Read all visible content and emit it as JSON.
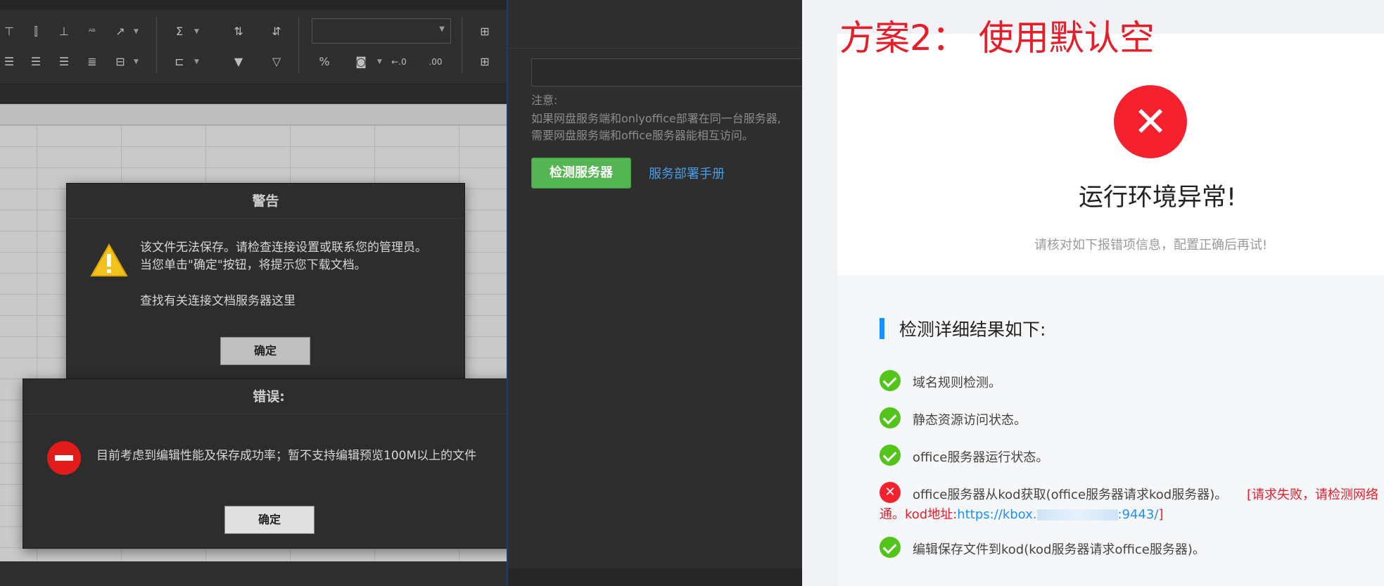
{
  "left": {
    "warning_dialog": {
      "title": "警告",
      "line1": "该文件无法保存。请检查连接设置或联系您的管理员。",
      "line2": "当您单击\"确定\"按钮，将提示您下载文档。",
      "line3": "查找有关连接文档服务器这里",
      "ok_label": "确定"
    },
    "error_dialog": {
      "title": "错误:",
      "message": "目前考虑到编辑性能及保存成功率；暂不支持编辑预览100M以上的文件",
      "ok_label": "确定"
    }
  },
  "middle": {
    "note_label": "注意:",
    "note_line1": "如果网盘服务端和onlyoffice部署在同一台服务器,",
    "note_line2": "需要网盘服务端和office服务器能相互访问。",
    "check_button": "检测服务器",
    "manual_link": "服务部署手册"
  },
  "right": {
    "annotation": "方案2：  使用默认空",
    "error_title": "运行环境异常!",
    "error_subtitle": "请核对如下报错项信息，配置正确后再试!",
    "detail_title": "检测详细结果如下:",
    "items": {
      "domain_rule": "域名规则检测。",
      "static_access": "静态资源访问状态。",
      "office_status": "office服务器运行状态。",
      "office_from_kod": "office服务器从kod获取(office服务器请求kod服务器)。",
      "office_from_kod_error": "[请求失败，请检测网络",
      "office_from_kod_error2": "通。kod地址:",
      "office_from_kod_url": "https://kbox.",
      "office_from_kod_url_tail": ":9443/",
      "office_from_kod_bracket": "]",
      "edit_save": "编辑保存文件到kod(kod服务器请求office服务器)。"
    },
    "colors": {
      "success": "#52c41a",
      "error": "#f5222d",
      "accent": "#1890ff",
      "annotation": "#e61e2a"
    }
  },
  "icons": [
    "warning-triangle-icon",
    "stop-icon",
    "error-x-icon",
    "check-icon"
  ]
}
